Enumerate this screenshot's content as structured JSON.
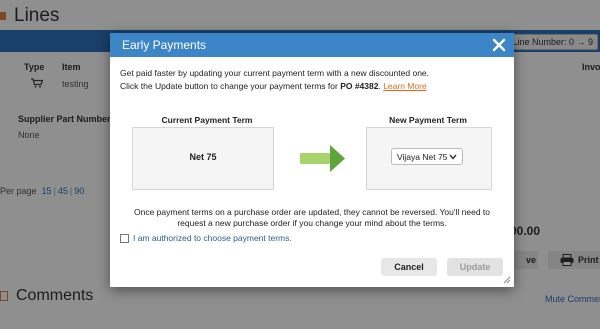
{
  "background": {
    "section_title": "Lines",
    "line_number_label": "Line Number: 0 → 9",
    "columns": {
      "type": "Type",
      "item": "Item",
      "right_edge": "Invo"
    },
    "row": {
      "item": "testing"
    },
    "supplier_part_number_label": "Supplier Part Number",
    "supplier_part_number_value": "None",
    "per_page": {
      "label": "Per page",
      "options": [
        "15",
        "45",
        "90"
      ]
    },
    "amount": "00.00",
    "ve_button": "ve",
    "print_button": "Print",
    "comments_title": "Comments",
    "mute_comments": "Mute Comments"
  },
  "modal": {
    "title": "Early Payments",
    "intro_line1": "Get paid faster by updating your current payment term with a new discounted one.",
    "intro_line2_prefix": "Click the Update button to change your payment terms for",
    "po_number": "PO #4382",
    "learn_more": "Learn More",
    "current_term_label": "Current Payment Term",
    "current_term_value": "Net 75",
    "new_term_label": "New Payment Term",
    "new_term_selected": "Vijaya Net 75",
    "warning_line1": "Once payment terms on a purchase order are updated, they cannot be reversed. You'll need to",
    "warning_line2": "request a new purchase order if you change your mind about the terms.",
    "authorized_label": "I am authorized to choose payment terms.",
    "cancel_button": "Cancel",
    "update_button": "Update"
  },
  "colors": {
    "header_blue": "#3c86c7",
    "link_orange": "#e06b1b",
    "arrow_green": "#a6d46b",
    "arrow_head": "#5ea53c"
  }
}
